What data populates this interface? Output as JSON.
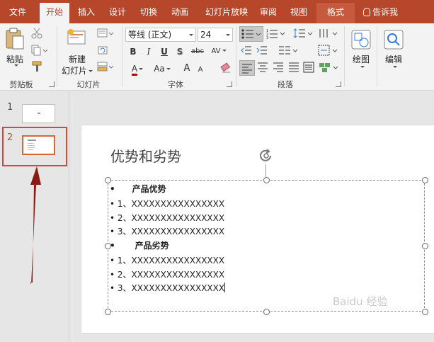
{
  "tabs": [
    {
      "label": "文件"
    },
    {
      "label": "开始"
    },
    {
      "label": "插入"
    },
    {
      "label": "设计"
    },
    {
      "label": "切换"
    },
    {
      "label": "动画"
    },
    {
      "label": "幻灯片放映"
    },
    {
      "label": "审阅"
    },
    {
      "label": "视图"
    },
    {
      "label": "格式"
    }
  ],
  "active_tab": "开始",
  "tell_me": "告诉我",
  "ribbon": {
    "clipboard": {
      "paste_label": "粘贴",
      "group_label": "剪贴板"
    },
    "slides": {
      "new_slide_line1": "新建",
      "new_slide_line2": "幻灯片",
      "group_label": "幻灯片"
    },
    "font": {
      "font_name": "等线 (正文)",
      "font_size": "24",
      "bold": "B",
      "italic": "I",
      "underline": "U",
      "shadow": "S",
      "strike": "abc",
      "spacing": "AV",
      "font_color": "A",
      "case": "Aa",
      "grow": "A",
      "shrink": "A",
      "group_label": "字体"
    },
    "paragraph": {
      "group_label": "段落"
    },
    "drawing": {
      "label": "绘图"
    },
    "editing": {
      "label": "编辑"
    }
  },
  "slides_pane": [
    {
      "number": "1"
    },
    {
      "number": "2"
    }
  ],
  "slide": {
    "title": "优势和劣势",
    "body": [
      {
        "bullet": "•",
        "text": "产品优势",
        "bold": true
      },
      {
        "bullet": "•",
        "text": "1、XXXXXXXXXXXXXXXX",
        "bold": false
      },
      {
        "bullet": "•",
        "text": "2、XXXXXXXXXXXXXXXX",
        "bold": false
      },
      {
        "bullet": "•",
        "text": "3、XXXXXXXXXXXXXXXX",
        "bold": false
      },
      {
        "bullet": "•",
        "text": "产品劣势",
        "bold": true
      },
      {
        "bullet": "•",
        "text": "1、XXXXXXXXXXXXXXXX",
        "bold": false
      },
      {
        "bullet": "•",
        "text": "2、XXXXXXXXXXXXXXXX",
        "bold": false
      },
      {
        "bullet": "•",
        "text": "3、XXXXXXXXXXXXXXXX",
        "bold": false
      }
    ]
  },
  "watermark": "Baidu 经验",
  "colors": {
    "accent": "#b7472a",
    "highlight_box": "#d9453b",
    "arrow": "#8b1a12"
  }
}
